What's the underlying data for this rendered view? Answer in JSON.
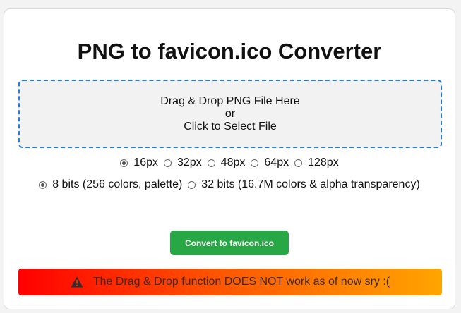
{
  "title": "PNG to favicon.ico Converter",
  "dropzone": {
    "line1": "Drag & Drop PNG File Here",
    "line2": "or",
    "line3": "Click to Select File"
  },
  "sizes": [
    {
      "label": "16px",
      "checked": true
    },
    {
      "label": "32px",
      "checked": false
    },
    {
      "label": "48px",
      "checked": false
    },
    {
      "label": "64px",
      "checked": false
    },
    {
      "label": "128px",
      "checked": false
    }
  ],
  "bits": [
    {
      "label": "8 bits (256 colors, palette)",
      "checked": true
    },
    {
      "label": "32 bits (16.7M colors & alpha transparency)",
      "checked": false
    }
  ],
  "convert_label": "Convert to favicon.ico",
  "warning": {
    "icon": "warning-triangle-icon",
    "text": "The Drag & Drop function DOES NOT work as of now sry :("
  },
  "colors": {
    "accent_blue": "#1e7fe0",
    "button_green": "#28a745",
    "warning_start": "#ff0000",
    "warning_end": "#ffa500"
  }
}
